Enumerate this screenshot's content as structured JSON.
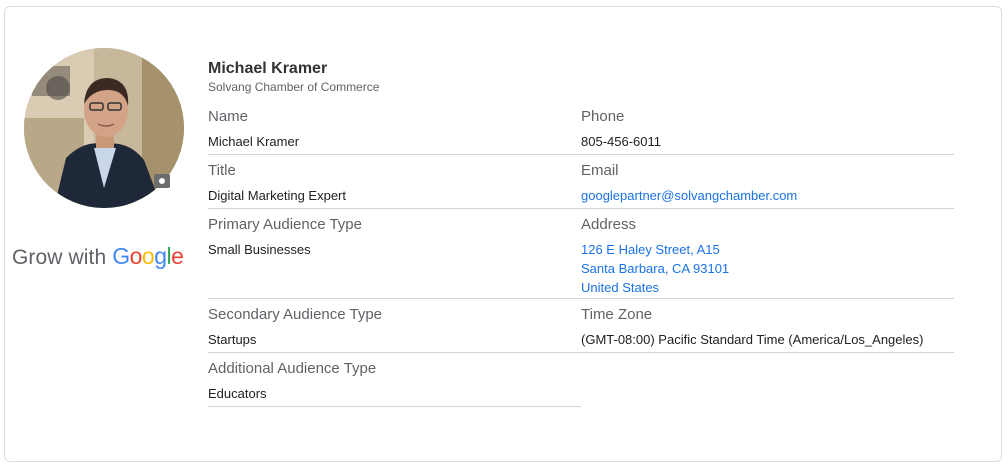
{
  "profile": {
    "name": "Michael Kramer",
    "organization": "Solvang Chamber of Commerce"
  },
  "brand": {
    "prefix": "Grow with",
    "google_letters": [
      {
        "char": "G",
        "color": "#4285F4"
      },
      {
        "char": "o",
        "color": "#EA4335"
      },
      {
        "char": "o",
        "color": "#FBBC05"
      },
      {
        "char": "g",
        "color": "#4285F4"
      },
      {
        "char": "l",
        "color": "#34A853"
      },
      {
        "char": "e",
        "color": "#EA4335"
      }
    ]
  },
  "fields": {
    "name": {
      "label": "Name",
      "value": "Michael Kramer"
    },
    "phone": {
      "label": "Phone",
      "value": "805-456-6011"
    },
    "title": {
      "label": "Title",
      "value": "Digital Marketing Expert"
    },
    "email": {
      "label": "Email",
      "value": "googlepartner@solvangchamber.com"
    },
    "primary_audience": {
      "label": "Primary Audience Type",
      "value": "Small Businesses"
    },
    "address": {
      "label": "Address",
      "line1": "126 E Haley Street, A15",
      "line2": "Santa Barbara, CA 93101",
      "line3": "United States"
    },
    "secondary_audience": {
      "label": "Secondary Audience Type",
      "value": "Startups"
    },
    "time_zone": {
      "label": "Time Zone",
      "value": "(GMT-08:00) Pacific Standard Time (America/Los_Angeles)"
    },
    "additional_audience": {
      "label": "Additional Audience Type",
      "value": "Educators"
    }
  },
  "colors": {
    "link": "#1a73e8",
    "label": "#5f6368",
    "divider": "#d4d4d4"
  },
  "icons": {
    "photo": "profile-photo",
    "camera": "camera-icon"
  }
}
